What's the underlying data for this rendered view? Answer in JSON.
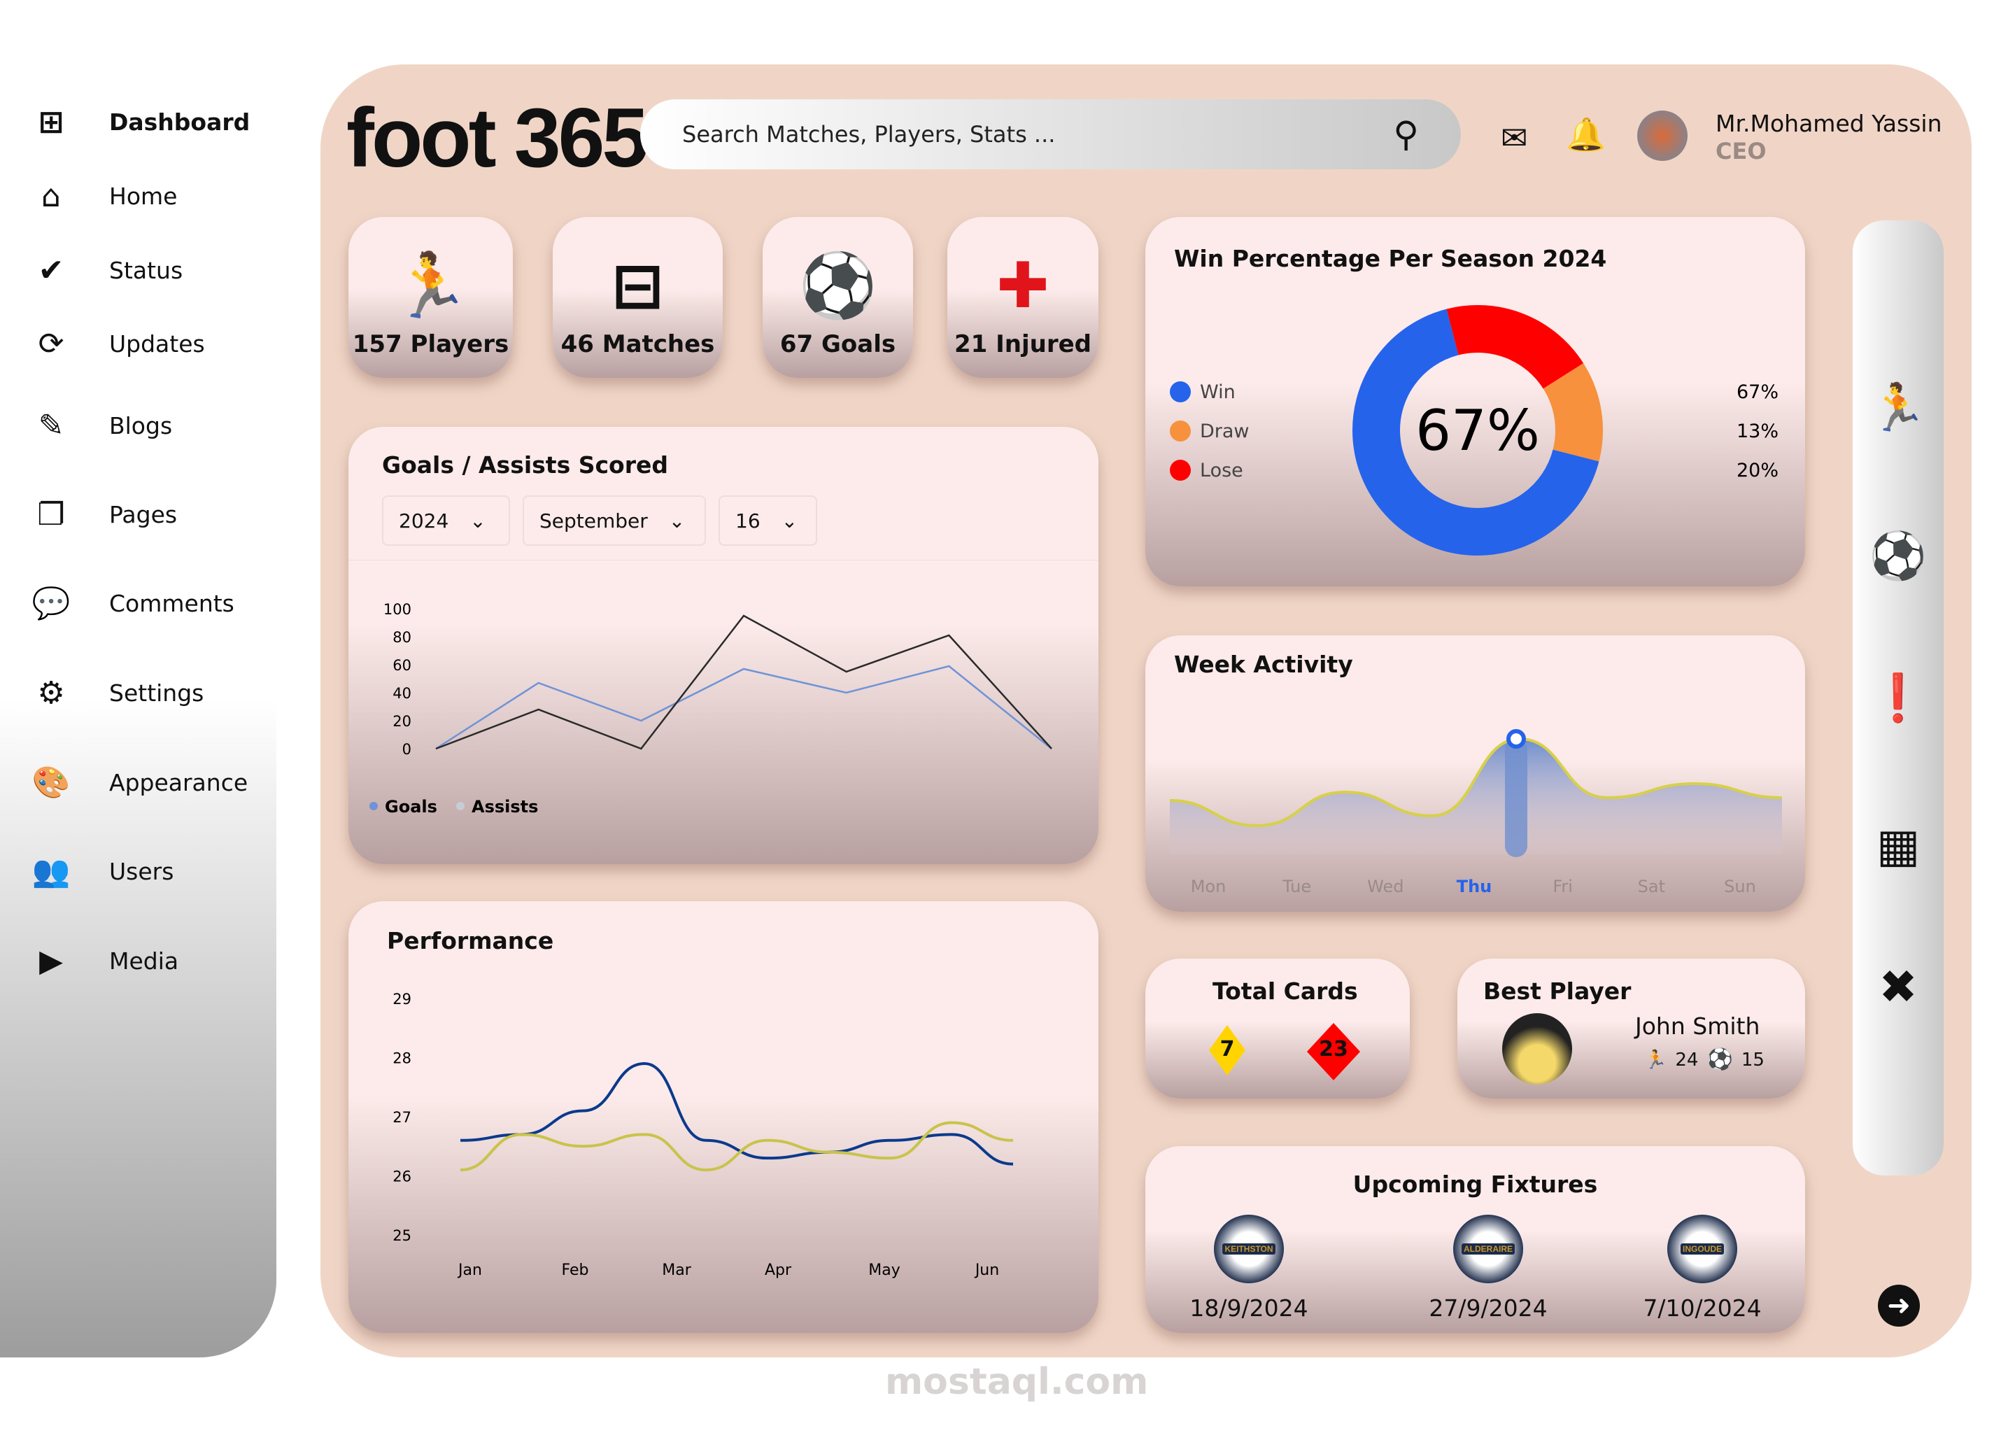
{
  "sidebar": {
    "items": [
      {
        "label": "Dashboard",
        "icon": "dashboard-icon",
        "glyph": "⊞"
      },
      {
        "label": "Home",
        "icon": "home-icon",
        "glyph": "⌂"
      },
      {
        "label": "Status",
        "icon": "check-circle-icon",
        "glyph": "✔"
      },
      {
        "label": "Updates",
        "icon": "refresh-icon",
        "glyph": "⟳"
      },
      {
        "label": "Blogs",
        "icon": "edit-icon",
        "glyph": "✎"
      },
      {
        "label": "Pages",
        "icon": "pages-icon",
        "glyph": "❐"
      },
      {
        "label": "Comments",
        "icon": "comments-icon",
        "glyph": "💬"
      },
      {
        "label": "Settings",
        "icon": "gear-icon",
        "glyph": "⚙"
      },
      {
        "label": "Appearance",
        "icon": "palette-icon",
        "glyph": "🎨"
      },
      {
        "label": "Users",
        "icon": "users-icon",
        "glyph": "👥"
      },
      {
        "label": "Media",
        "icon": "play-icon",
        "glyph": "▶"
      }
    ]
  },
  "header": {
    "logo_text": "foot",
    "logo_num": "365",
    "search_placeholder": "Search Matches, Players, Stats ...",
    "user_name": "Mr.Mohamed Yassin",
    "user_role": "CEO"
  },
  "stats": [
    {
      "label": "157 Players",
      "glyph": "🏃"
    },
    {
      "label": "46 Matches",
      "glyph": "⊟"
    },
    {
      "label": "67 Goals",
      "glyph": "⚽"
    },
    {
      "label": "21 Injured",
      "glyph": "✚"
    }
  ],
  "goals_card": {
    "title": "Goals / Assists Scored",
    "filters": [
      "2024",
      "September",
      "16"
    ]
  },
  "chart_data": [
    {
      "type": "line",
      "title": "Goals / Assists Scored",
      "yticks": [
        0,
        20,
        40,
        60,
        80,
        100
      ],
      "ylim": [
        0,
        100
      ],
      "legend": "bottom-left",
      "series": [
        {
          "name": "Goals",
          "color": "#6f93d6",
          "values": [
            0,
            47,
            20,
            57,
            40,
            59,
            0
          ]
        },
        {
          "name": "Assists",
          "color": "#2a2a2a",
          "values": [
            0,
            28,
            0,
            95,
            55,
            81,
            0
          ]
        }
      ]
    },
    {
      "type": "line",
      "title": "Performance",
      "categories": [
        "Jan",
        "Feb",
        "Mar",
        "Apr",
        "May",
        "Jun"
      ],
      "yticks": [
        25,
        26,
        27,
        28,
        29
      ],
      "ylim": [
        25,
        29
      ],
      "series": [
        {
          "color": "#0b3a8c",
          "values": [
            26.6,
            26.7,
            27.1,
            27.9,
            26.6,
            26.3,
            26.4,
            26.6,
            26.7,
            26.2
          ]
        },
        {
          "color": "#c9c34a",
          "values": [
            26.1,
            26.7,
            26.5,
            26.7,
            26.1,
            26.6,
            26.4,
            26.3,
            26.9,
            26.6
          ]
        }
      ]
    },
    {
      "type": "pie",
      "title": "Win Percentage Per Season 2024",
      "center_label": "67%",
      "categories": [
        "Win",
        "Draw",
        "Lose"
      ],
      "values": [
        67,
        13,
        20
      ],
      "colors": [
        "#2563eb",
        "#f7913d",
        "#ff0000"
      ]
    },
    {
      "type": "area",
      "title": "Week Activity",
      "categories": [
        "Mon",
        "Tue",
        "Wed",
        "Thu",
        "Fri",
        "Sat",
        "Sun"
      ],
      "highlight": "Thu",
      "values": [
        38,
        20,
        44,
        27,
        82,
        40,
        50,
        40
      ]
    }
  ],
  "total_cards": {
    "title": "Total Cards",
    "yellow": "7",
    "red": "23"
  },
  "best_player": {
    "title": "Best Player",
    "name": "John Smith",
    "matches": "24",
    "goals": "15"
  },
  "fixtures": {
    "title": "Upcoming Fixtures",
    "items": [
      {
        "date": "18/9/2024",
        "club": "KEITHSTON"
      },
      {
        "date": "27/9/2024",
        "club": "ALDERAIRE"
      },
      {
        "date": "7/10/2024",
        "club": "INGOUDE"
      }
    ]
  },
  "rail": [
    {
      "icon": "player-kick-icon",
      "glyph": "🏃"
    },
    {
      "icon": "fire-ball-icon",
      "glyph": "⚽"
    },
    {
      "icon": "foul-card-icon",
      "glyph": "❗"
    },
    {
      "icon": "tactics-board-icon",
      "glyph": "▦"
    },
    {
      "icon": "strategy-icon",
      "glyph": "✖"
    }
  ],
  "watermark": "mostaql.com"
}
